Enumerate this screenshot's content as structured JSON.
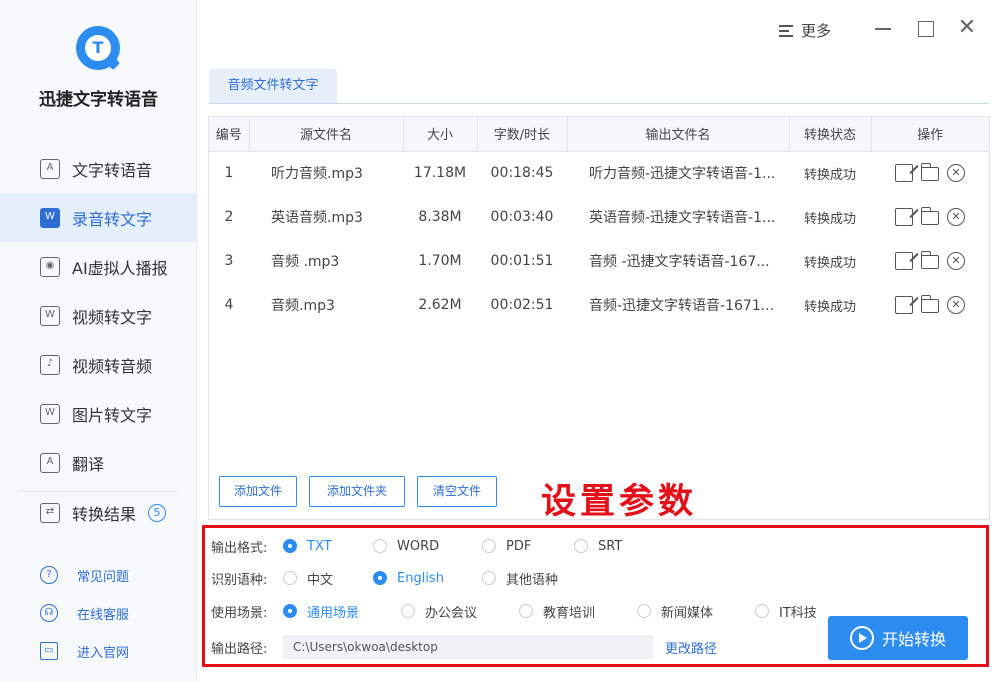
{
  "app": {
    "title": "迅捷文字转语音"
  },
  "sidebar": {
    "items": [
      {
        "label": "文字转语音",
        "icon": "text-to-speech-icon"
      },
      {
        "label": "录音转文字",
        "icon": "recording-to-text-icon",
        "active": true
      },
      {
        "label": "AI虚拟人播报",
        "icon": "ai-avatar-icon"
      },
      {
        "label": "视频转文字",
        "icon": "video-to-text-icon"
      },
      {
        "label": "视频转音频",
        "icon": "video-to-audio-icon"
      },
      {
        "label": "图片转文字",
        "icon": "image-to-text-icon"
      },
      {
        "label": "翻译",
        "icon": "translate-icon"
      }
    ],
    "result": {
      "label": "转换结果",
      "count": "5"
    },
    "links": [
      {
        "label": "常见问题",
        "icon": "help-icon"
      },
      {
        "label": "在线客服",
        "icon": "headset-icon"
      },
      {
        "label": "进入官网",
        "icon": "monitor-icon"
      }
    ]
  },
  "topbar": {
    "more_label": "更多"
  },
  "tab": {
    "label": "音频文件转文字"
  },
  "table": {
    "headers": [
      "编号",
      "源文件名",
      "大小",
      "字数/时长",
      "输出文件名",
      "转换状态",
      "操作"
    ],
    "rows": [
      {
        "no": "1",
        "name": "听力音频.mp3",
        "size": "17.18M",
        "duration": "00:18:45",
        "output": "听力音频-迅捷文字转语音-1...",
        "status": "转换成功"
      },
      {
        "no": "2",
        "name": "英语音频.mp3",
        "size": "8.38M",
        "duration": "00:03:40",
        "output": "英语音频-迅捷文字转语音-1...",
        "status": "转换成功"
      },
      {
        "no": "3",
        "name": "音频 .mp3",
        "size": "1.70M",
        "duration": "00:01:51",
        "output": "音频 -迅捷文字转语音-167...",
        "status": "转换成功"
      },
      {
        "no": "4",
        "name": "音频.mp3",
        "size": "2.62M",
        "duration": "00:02:51",
        "output": "音频-迅捷文字转语音-1671...",
        "status": "转换成功"
      }
    ]
  },
  "buttons": {
    "add_file": "添加文件",
    "add_folder": "添加文件夹",
    "clear": "清空文件"
  },
  "annotation": "设置参数",
  "settings": {
    "format": {
      "label": "输出格式:",
      "options": [
        "TXT",
        "WORD",
        "PDF",
        "SRT"
      ],
      "selected": 0
    },
    "language": {
      "label": "识别语种:",
      "options": [
        "中文",
        "English",
        "其他语种"
      ],
      "selected": 1
    },
    "scene": {
      "label": "使用场景:",
      "options": [
        "通用场景",
        "办公会议",
        "教育培训",
        "新闻媒体",
        "IT科技"
      ],
      "selected": 0
    },
    "path": {
      "label": "输出路径:",
      "value": "C:\\Users\\okwoa\\desktop",
      "change_label": "更改路径"
    },
    "start_label": "开始转换"
  },
  "colors": {
    "accent": "#2d8cf0",
    "annotation": "#e3101a",
    "active_bg": "#e5eefb"
  }
}
